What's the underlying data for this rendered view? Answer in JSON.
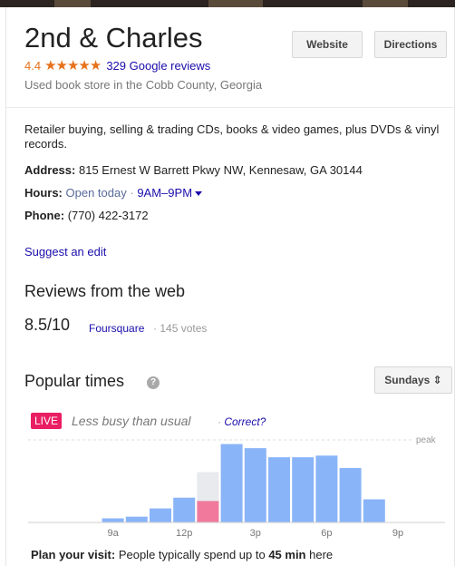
{
  "place": {
    "name": "2nd & Charles",
    "rating": "4.4",
    "stars_icon": "star-rating-icon",
    "stars_glyphs": "★★★★★",
    "reviews_link": "329 Google reviews",
    "category": "Used book store in the Cobb County, Georgia"
  },
  "actions": {
    "website_label": "Website",
    "directions_label": "Directions"
  },
  "details": {
    "description": "Retailer buying, selling & trading CDs, books & video games, plus DVDs & vinyl records.",
    "address_label": "Address:",
    "address_value": "815 Ernest W Barrett Pkwy NW, Kennesaw, GA 30144",
    "hours_label": "Hours:",
    "hours_status": "Open today",
    "hours_separator": "·",
    "hours_range": "9AM–9PM",
    "phone_label": "Phone:",
    "phone_value": "(770) 422-3172",
    "suggest_edit": "Suggest an edit"
  },
  "reviews_web": {
    "title": "Reviews from the web",
    "score": "8.5/10",
    "source": "Foursquare",
    "separator": "·",
    "votes": "145 votes"
  },
  "popular_times": {
    "title": "Popular times",
    "help_glyph": "?",
    "day_selector": "Sundays ⇕",
    "live_badge": "LIVE",
    "live_status": "Less busy than usual",
    "separator": "·",
    "correct_link": "Correct?",
    "plan_label": "Plan your visit:",
    "plan_text_before": " People typically spend up to ",
    "plan_duration": "45 min",
    "plan_text_after": " here",
    "colors": {
      "usual": "#8ab4f8",
      "live": "#f0799c",
      "live_shadow": "#e8eaed",
      "live_badge": "#e91e63"
    }
  },
  "chart_data": {
    "type": "bar",
    "peak_label": "peak",
    "x_tick_labels": [
      "9a",
      "12p",
      "3p",
      "6p",
      "9p"
    ],
    "hours": [
      "6a",
      "7a",
      "8a",
      "9a",
      "10a",
      "11a",
      "12p",
      "1p",
      "2p",
      "3p",
      "4p",
      "5p",
      "6p",
      "7p",
      "8p",
      "9p",
      "10p"
    ],
    "usual_values": [
      0,
      0,
      0,
      5,
      7,
      17,
      30,
      0,
      95,
      90,
      79,
      79,
      81,
      66,
      28,
      0,
      0
    ],
    "live_hour_index": 7,
    "live_usual_value": 61,
    "live_value": 26,
    "ylim": [
      0,
      100
    ]
  }
}
